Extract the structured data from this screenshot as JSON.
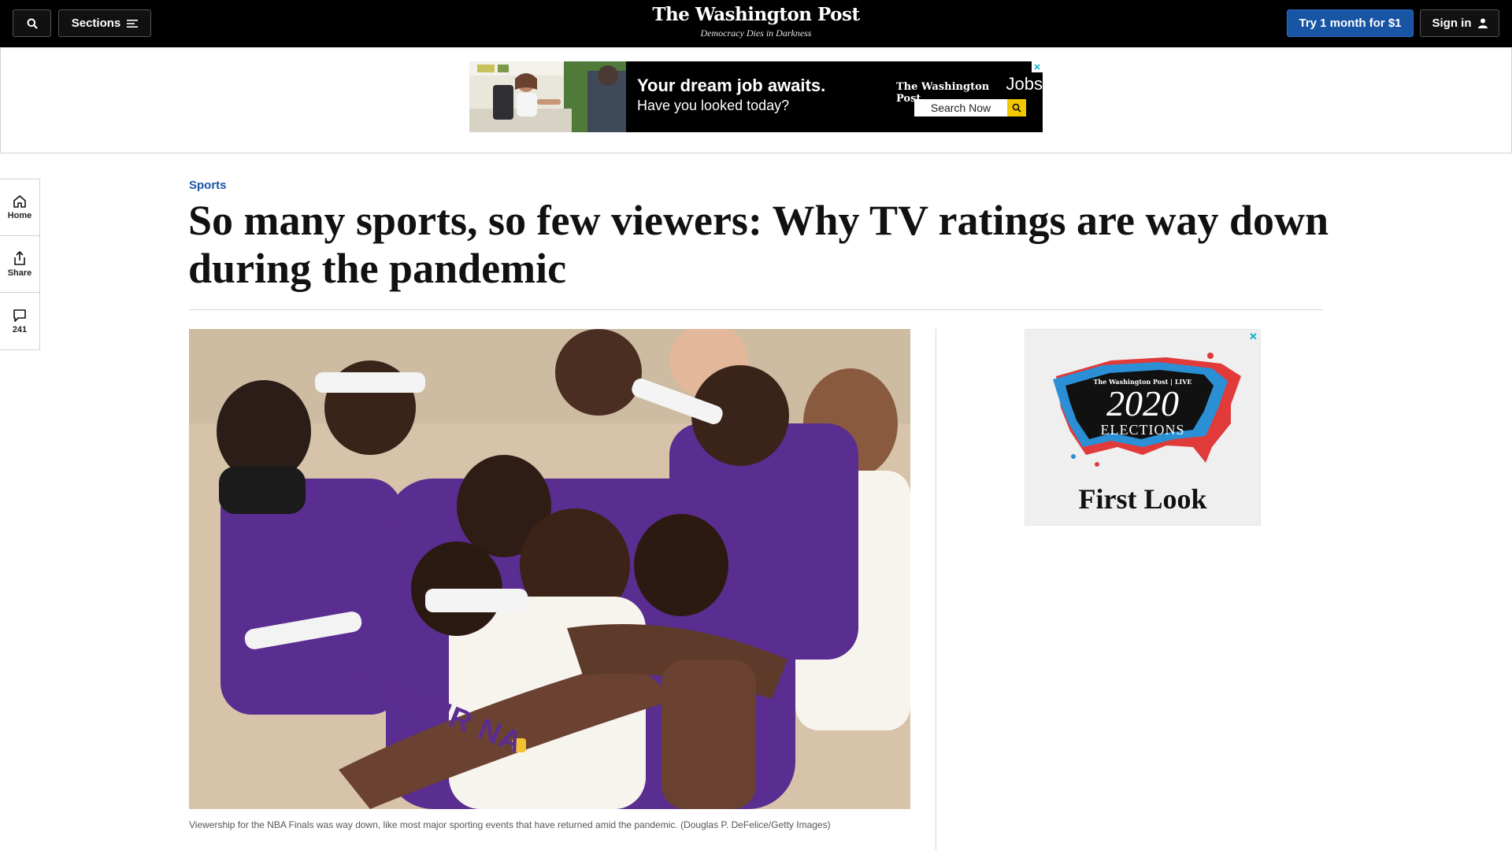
{
  "nav": {
    "sections_label": "Sections",
    "logo": "The Washington Post",
    "tagline": "Democracy Dies in Darkness",
    "trial_label": "Try 1 month for $1",
    "signin_label": "Sign in"
  },
  "top_ad": {
    "headline": "Your dream job awaits.",
    "subline": "Have you looked today?",
    "brand_logo": "The Washington Post",
    "brand_word": "Jobs",
    "search_label": "Search Now",
    "adchoice": "✕"
  },
  "rail": {
    "home_label": "Home",
    "share_label": "Share",
    "comments_count": "241"
  },
  "article": {
    "kicker": "Sports",
    "headline": "So many sports, so few viewers: Why TV ratings are way down during the pandemic",
    "caption": "Viewership for the NBA Finals was way down, like most major sporting events that have returned amid the pandemic. (Douglas P. DeFelice/Getty Images)",
    "jersey_text": "Y THEIR NA"
  },
  "side_ad": {
    "brand": "The Washington Post | LIVE",
    "year": "2020",
    "word": "ELECTIONS",
    "title": "First Look",
    "close": "✕"
  },
  "colors": {
    "nav_bg": "#000000",
    "accent_blue": "#1955a5",
    "kicker_blue": "#1955a5",
    "lakers_purple": "#5a2d91",
    "lakers_gold": "#f1c232",
    "map_red": "#e03a3a",
    "map_blue": "#2b8fd6"
  }
}
